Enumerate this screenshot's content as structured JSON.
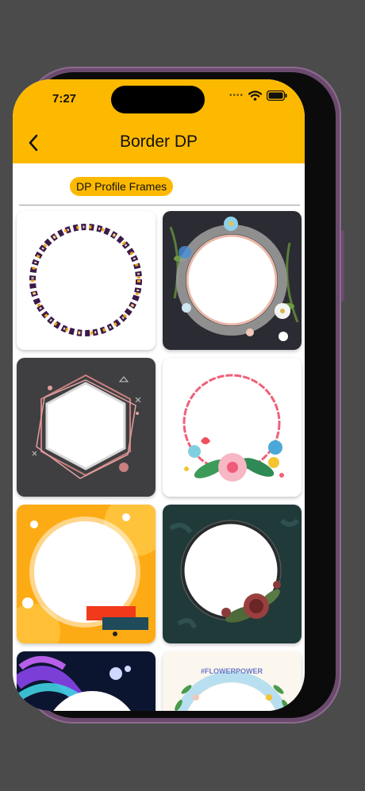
{
  "status_bar": {
    "time": "7:27"
  },
  "header": {
    "title": "Border DP",
    "back_icon": "chevron-left-icon"
  },
  "tabs": {
    "active_label": "DP Profile Frames"
  },
  "frames": [
    {
      "name": "floral-ring-frame"
    },
    {
      "name": "flower-neon-ring-frame"
    },
    {
      "name": "hexagon-frame"
    },
    {
      "name": "wavy-flower-frame"
    },
    {
      "name": "orange-circle-frame"
    },
    {
      "name": "rose-ring-frame"
    },
    {
      "name": "neon-wave-frame"
    },
    {
      "name": "flowerpower-frame",
      "text": "#FLOWERPOWER"
    }
  ],
  "colors": {
    "accent": "#FDB900"
  }
}
